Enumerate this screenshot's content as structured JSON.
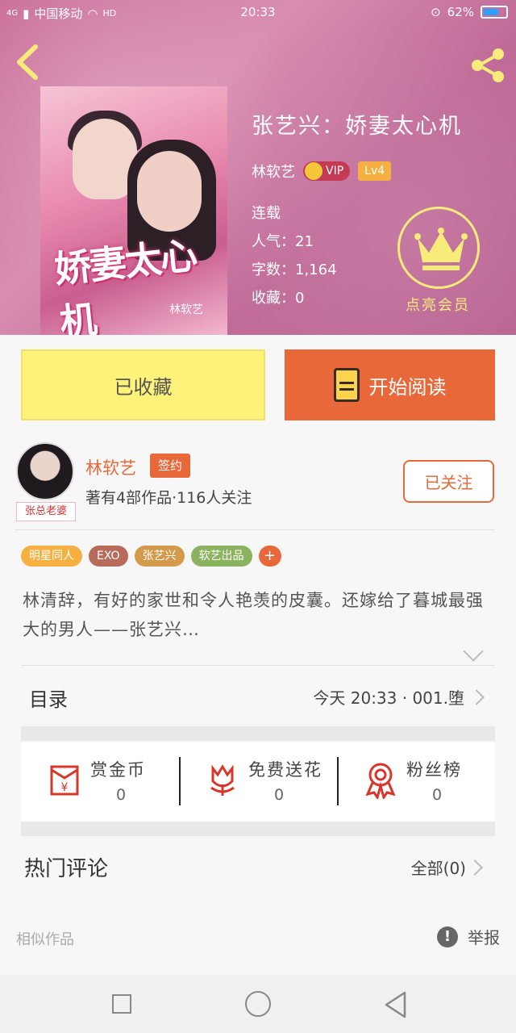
{
  "status_bar": {
    "carrier": "中国移动",
    "network": "4G",
    "hd": "HD",
    "time": "20:33",
    "battery": "62%"
  },
  "book": {
    "title": "张艺兴：娇妻太心机",
    "author": "林软艺",
    "vip_label": "VIP",
    "level": "Lv4",
    "status": "连载",
    "popularity": "人气：21",
    "word_count": "字数：1,164",
    "favorites": "收藏：0",
    "cover_title": "娇妻太心机",
    "cover_author": "林软艺"
  },
  "vip_promo": {
    "label": "点亮会员",
    "accent": "#f7eb7a"
  },
  "actions": {
    "fav_label": "已收藏",
    "read_label": "开始阅读"
  },
  "author_card": {
    "name": "林软艺",
    "sign_tag": "签约",
    "stats": "著有4部作品·116人关注",
    "follow_label": "已关注",
    "avatar_tag": "张总老婆"
  },
  "tags": [
    "明星同人",
    "EXO",
    "张艺兴",
    "软艺出品",
    "+"
  ],
  "synopsis": "林清辞，有好的家世和令人艳羡的皮囊。还嫁给了暮城最强大的男人——张艺兴…",
  "toc": {
    "label": "目录",
    "latest": "今天 20:33 · 001.堕"
  },
  "stats": [
    {
      "icon": "red-envelope-icon",
      "label": "赏金币",
      "value": "0"
    },
    {
      "icon": "flower-icon",
      "label": "免费送花",
      "value": "0"
    },
    {
      "icon": "ribbon-award-icon",
      "label": "粉丝榜",
      "value": "0"
    }
  ],
  "comments": {
    "label": "热门评论",
    "all": "全部(0)"
  },
  "footer": {
    "similar": "相似作品",
    "report": "举报"
  },
  "colors": {
    "accent": "#e8683a",
    "fav_yellow": "#fef27a",
    "hero_pink": "#c86b95"
  }
}
